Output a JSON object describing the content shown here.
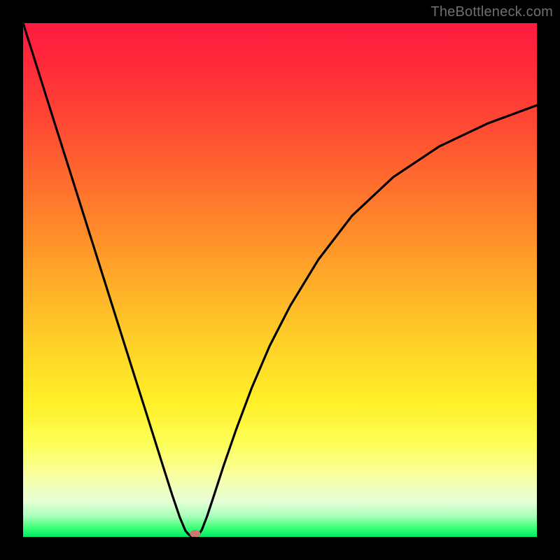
{
  "watermark": "TheBottleneck.com",
  "chart_data": {
    "type": "line",
    "title": "",
    "xlabel": "",
    "ylabel": "",
    "xlim": [
      0,
      1
    ],
    "ylim": [
      0,
      1
    ],
    "series": [
      {
        "name": "bottleneck-curve",
        "x": [
          0.0,
          0.03,
          0.06,
          0.09,
          0.12,
          0.15,
          0.18,
          0.21,
          0.24,
          0.27,
          0.29,
          0.305,
          0.316,
          0.323,
          0.33,
          0.335,
          0.34,
          0.348,
          0.358,
          0.372,
          0.39,
          0.415,
          0.445,
          0.48,
          0.52,
          0.575,
          0.64,
          0.72,
          0.81,
          0.905,
          1.0
        ],
        "y": [
          1.0,
          0.905,
          0.81,
          0.715,
          0.62,
          0.525,
          0.43,
          0.335,
          0.24,
          0.145,
          0.082,
          0.038,
          0.012,
          0.004,
          0.0,
          0.0,
          0.002,
          0.014,
          0.04,
          0.082,
          0.138,
          0.21,
          0.29,
          0.372,
          0.45,
          0.54,
          0.625,
          0.7,
          0.76,
          0.805,
          0.84
        ]
      }
    ],
    "marker": {
      "x": 0.335,
      "y": 0.006,
      "color": "#c97a6e"
    },
    "background_gradient": {
      "top": "#ff1a40",
      "mid": "#ffd028",
      "bottom": "#00e868"
    }
  }
}
